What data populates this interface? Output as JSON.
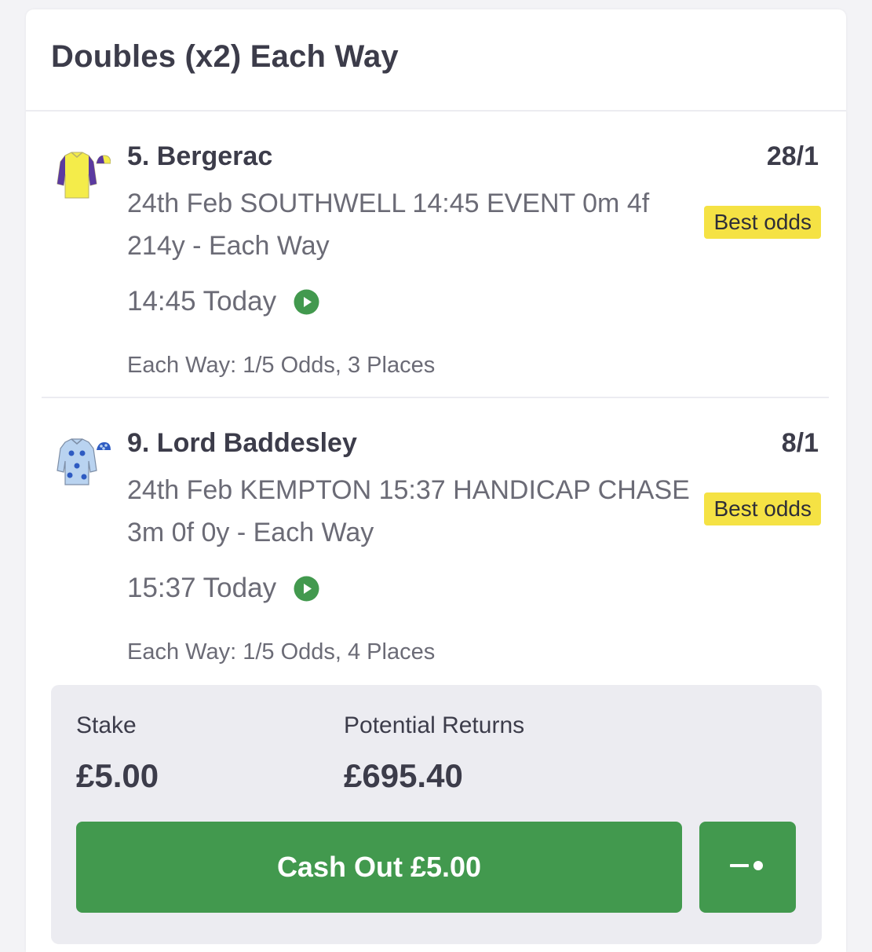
{
  "bet": {
    "title": "Doubles (x2) Each Way"
  },
  "selections": [
    {
      "name": "5. Bergerac",
      "odds": "28/1",
      "badge": "Best odds",
      "event": "24th Feb SOUTHWELL 14:45 EVENT 0m 4f 214y - Each Way",
      "time": "14:45 Today",
      "terms": "Each Way: 1/5 Odds, 3 Places",
      "silks_icon": "jockey-silks-yellow-purple-icon",
      "silks_colors": {
        "body": "#f4ec4a",
        "sleeves": "#5b3aa0",
        "cap": "#f4ec4a"
      }
    },
    {
      "name": "9. Lord Baddesley",
      "odds": "8/1",
      "badge": "Best odds",
      "event": "24th Feb KEMPTON 15:37 HANDICAP CHASE 3m 0f 0y - Each Way",
      "time": "15:37 Today",
      "terms": "Each Way: 1/5 Odds, 4 Places",
      "silks_icon": "jockey-silks-lightblue-spots-icon",
      "silks_colors": {
        "body": "#b9d3f0",
        "spots": "#2e5bc2",
        "cap": "#2e5bc2"
      }
    }
  ],
  "stake": {
    "label": "Stake",
    "value": "£5.00"
  },
  "returns": {
    "label": "Potential Returns",
    "value": "£695.40"
  },
  "cashout": {
    "label": "Cash Out £5.00"
  },
  "colors": {
    "accent_green": "#42994e",
    "best_odds_yellow": "#f5e244",
    "text_dark": "#3c3c4a",
    "text_muted": "#6b6b76"
  },
  "icons": {
    "play": "live-stream-play-icon",
    "slider": "partial-cashout-slider-icon"
  }
}
